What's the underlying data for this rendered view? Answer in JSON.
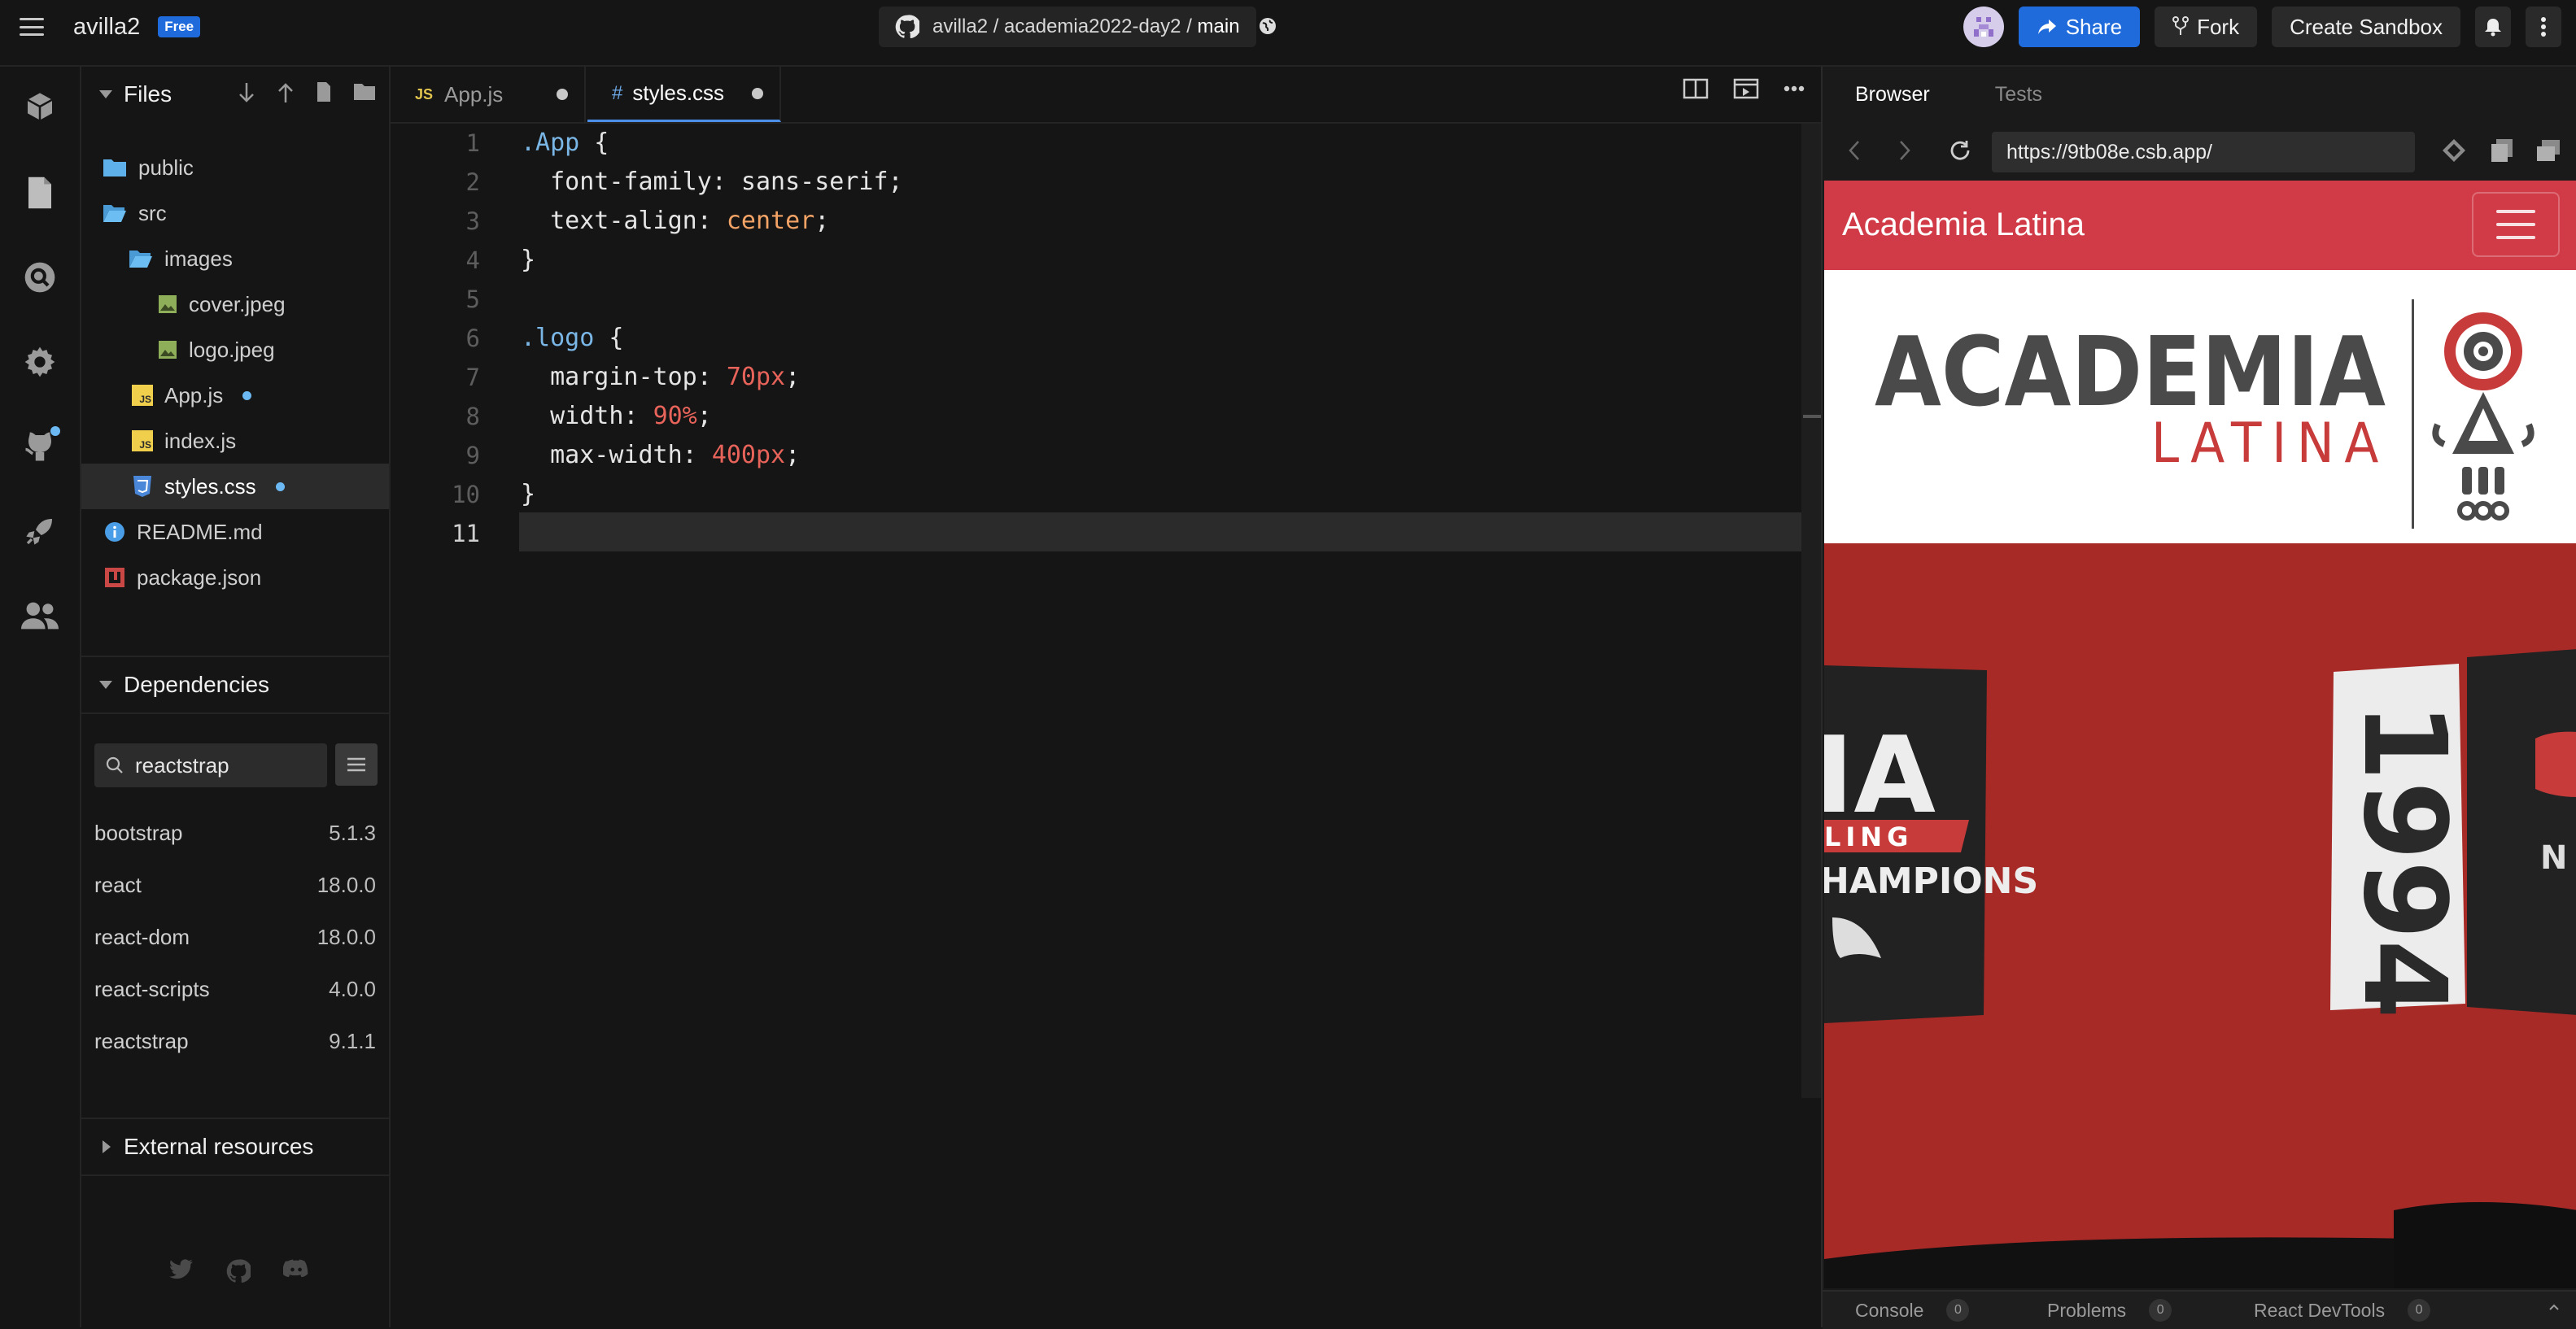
{
  "topbar": {
    "username": "avilla2",
    "plan": "Free",
    "repo_path": "avilla2 / academia2022-day2 / ",
    "branch": "main",
    "share_label": "Share",
    "fork_label": "Fork",
    "create_label": "Create Sandbox"
  },
  "sidebar": {
    "files_title": "Files",
    "items": [
      {
        "label": "public"
      },
      {
        "label": "src"
      },
      {
        "label": "images"
      },
      {
        "label": "cover.jpeg"
      },
      {
        "label": "logo.jpeg"
      },
      {
        "label": "App.js"
      },
      {
        "label": "index.js"
      },
      {
        "label": "styles.css"
      },
      {
        "label": "README.md"
      },
      {
        "label": "package.json"
      }
    ],
    "dependencies_title": "Dependencies",
    "dependency_search": "reactstrap",
    "dependencies": [
      {
        "name": "bootstrap",
        "version": "5.1.3"
      },
      {
        "name": "react",
        "version": "18.0.0"
      },
      {
        "name": "react-dom",
        "version": "18.0.0"
      },
      {
        "name": "react-scripts",
        "version": "4.0.0"
      },
      {
        "name": "reactstrap",
        "version": "9.1.1"
      }
    ],
    "external_title": "External resources"
  },
  "editor": {
    "tabs": [
      {
        "label": "App.js",
        "badge": "JS"
      },
      {
        "label": "styles.css",
        "badge": "#"
      }
    ],
    "line_numbers": [
      "1",
      "2",
      "3",
      "4",
      "5",
      "6",
      "7",
      "8",
      "9",
      "10",
      "11"
    ],
    "code": {
      "l1_sel": ".App",
      "l1_rest": " {",
      "l2": "  font-family: sans-serif;",
      "l3_a": "  text-align: ",
      "l3_v": "center",
      "l3_b": ";",
      "l4": "}",
      "l6_sel": ".logo",
      "l6_rest": " {",
      "l7_a": "  margin-top: ",
      "l7_v": "70px",
      "l7_b": ";",
      "l8_a": "  width: ",
      "l8_v": "90%",
      "l8_b": ";",
      "l9_a": "  max-width: ",
      "l9_v": "400px",
      "l9_b": ";",
      "l10": "}"
    }
  },
  "preview": {
    "tabs": [
      "Browser",
      "Tests"
    ],
    "url": "https://9tb08e.csb.app/",
    "brand": "Academia Latina",
    "logo_word1": "ACADEMIA",
    "logo_word2": "LATINA",
    "banner_line1": "IA",
    "banner_line2": "LING",
    "banner_line3": "HAMPIONS",
    "bib_number": "1994",
    "bib_side": "N",
    "footer": [
      {
        "label": "Console",
        "count": "0"
      },
      {
        "label": "Problems",
        "count": "0"
      },
      {
        "label": "React DevTools",
        "count": "0"
      }
    ]
  },
  "colors": {
    "accent": "#1f6bdc",
    "navbar_red": "#d13b47",
    "cover_red": "#a82a27",
    "modified_dot": "#6cb8f2"
  }
}
